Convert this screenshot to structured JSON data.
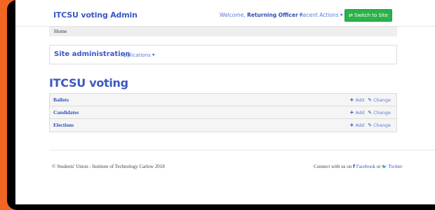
{
  "navbar": {
    "brand": "ITCSU voting Admin",
    "welcome_prefix": "Welcome, ",
    "welcome_user": "Returning Officer",
    "recent_actions": "Recent Actions",
    "switch_button": "Switch to Site",
    "switch_icon": "exchange-arrows-icon"
  },
  "breadcrumb": {
    "home": "Home"
  },
  "site_admin": {
    "title": "Site administration",
    "applications": "Applications"
  },
  "app": {
    "title": "ITCSU voting",
    "models": [
      {
        "name": "Ballots",
        "add": "Add",
        "change": "Change"
      },
      {
        "name": "Candidates",
        "add": "Add",
        "change": "Change"
      },
      {
        "name": "Elections",
        "add": "Add",
        "change": "Change"
      }
    ]
  },
  "footer": {
    "copyright": "© Students' Union - Institute of Technology Carlow 2018",
    "connect_prefix": "Connect with us on ",
    "facebook": "Facebook",
    "or": " or ",
    "twitter": "Twitter"
  },
  "colors": {
    "accent": "#3b57c4",
    "switch_button": "#2bb24a",
    "outer_background": "#f26522"
  }
}
